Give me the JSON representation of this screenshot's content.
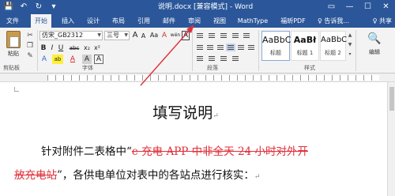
{
  "window": {
    "title": "说明.docx [兼容模式] - Word",
    "controls": [
      "▭",
      "—",
      "☐",
      "✕"
    ]
  },
  "qat": {
    "save_icon": "save-icon",
    "undo_icon": "undo-icon",
    "redo_icon": "redo-icon",
    "more_icon": "chevron-down-icon"
  },
  "tabs": [
    {
      "label": "文件"
    },
    {
      "label": "开始"
    },
    {
      "label": "插入"
    },
    {
      "label": "设计"
    },
    {
      "label": "布局"
    },
    {
      "label": "引用"
    },
    {
      "label": "邮件"
    },
    {
      "label": "审阅"
    },
    {
      "label": "视图"
    },
    {
      "label": "MathType"
    },
    {
      "label": "福昕PDF"
    },
    {
      "label": "♀ 告诉我..."
    }
  ],
  "share_label": "♀ 共享",
  "ribbon": {
    "clipboard": {
      "paste_label": "粘贴",
      "group_label": "剪贴板"
    },
    "font": {
      "font_name": "仿宋_GB2312",
      "font_size": "三号",
      "grow": "A",
      "shrink": "A",
      "case": "Aa",
      "clear": "A",
      "phonetic": "wén",
      "border": "A",
      "bold": "B",
      "italic": "I",
      "underline": "U",
      "strike": "abc",
      "subscript": "x₂",
      "superscript": "x²",
      "effects": "A",
      "highlight": "ab",
      "color": "A",
      "shading": "A",
      "charborder": "A",
      "group_label": "字体"
    },
    "paragraph": {
      "group_label": "段落"
    },
    "styles": {
      "tiles": [
        {
          "sample": "AaBbC",
          "name": "标题"
        },
        {
          "sample": "AaBł",
          "name": "标题 1"
        },
        {
          "sample": "AaBbC",
          "name": "标题 2"
        }
      ],
      "group_label": "样式"
    },
    "edit": {
      "label": "编辑"
    }
  },
  "document": {
    "heading": "填写说明",
    "para1_prefix": "针对附件二表格中“",
    "para1_deleted": "e 充电 APP 中非全天 24 小时对外开",
    "para2_deleted": "放充电站",
    "para2_suffix": "”，各供电单位对表中的各站点进行核实：",
    "para_mark": "↵"
  },
  "colors": {
    "accent": "#2b579a",
    "deleted_text": "#e0303a",
    "annotation_arrow": "#e0303a"
  }
}
